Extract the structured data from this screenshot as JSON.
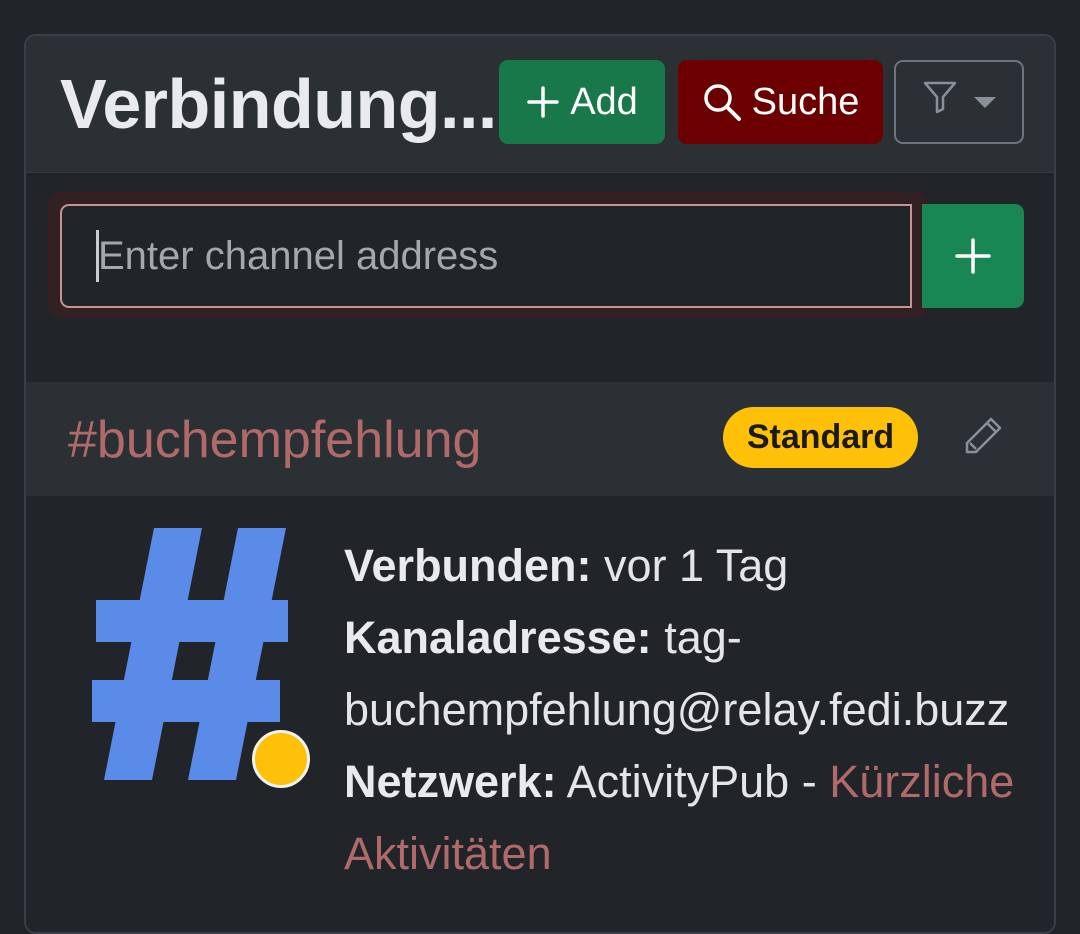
{
  "header": {
    "title": "Verbindung...",
    "add_label": "Add",
    "search_label": "Suche"
  },
  "channel_form": {
    "placeholder": "Enter channel address"
  },
  "connection": {
    "name": "#buchempfehlung",
    "badge": "Standard",
    "connected_label": "Verbunden:",
    "connected_value": "vor 1 Tag",
    "address_label": "Kanaladresse:",
    "address_value_part1": "tag-",
    "address_value_part2": "buchempfehlung@relay.fedi.buzz",
    "network_label": "Netzwerk:",
    "network_value": "ActivityPub -",
    "recent_link_part1": "Kürzliche",
    "recent_link_part2": "Aktivitäten"
  },
  "colors": {
    "add_button": "#19784a",
    "search_button": "#6c0000",
    "badge": "#ffc107",
    "link": "#b06a6a",
    "avatar_hash": "#5a8be8"
  }
}
